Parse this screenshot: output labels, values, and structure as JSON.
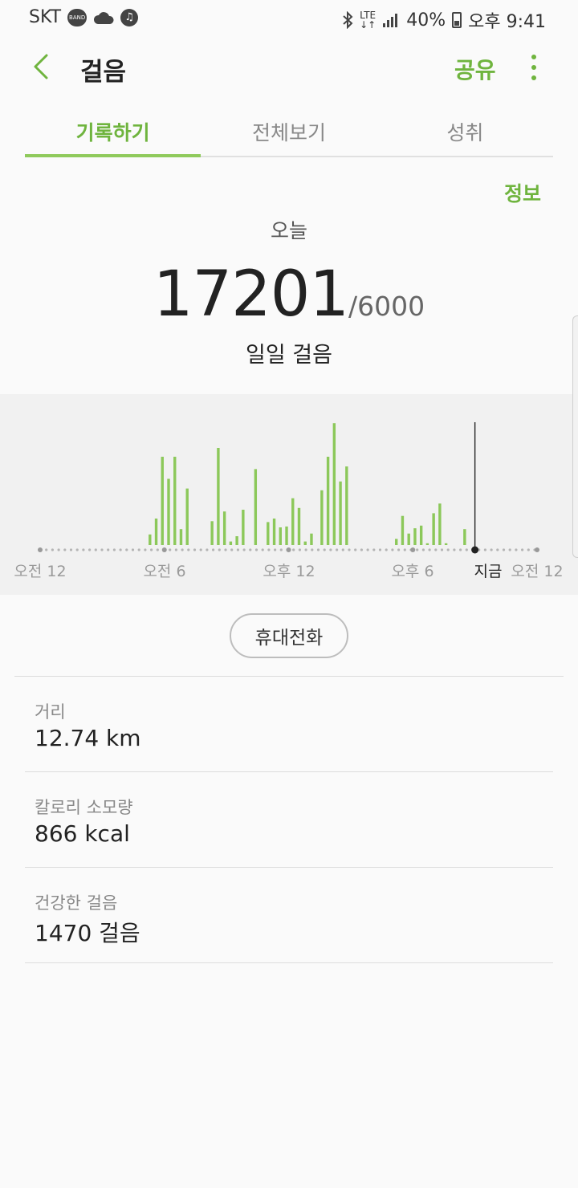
{
  "status_bar": {
    "carrier": "SKT",
    "network": "LTE",
    "battery": "40%",
    "time": "오후 9:41",
    "icons": [
      "band-icon",
      "cloud-icon",
      "music-icon",
      "bluetooth-icon",
      "lte-icon",
      "signal-icon",
      "battery-icon"
    ]
  },
  "app_bar": {
    "title": "걸음",
    "share": "공유"
  },
  "tabs": [
    {
      "label": "기록하기",
      "active": true
    },
    {
      "label": "전체보기",
      "active": false
    },
    {
      "label": "성취",
      "active": false
    }
  ],
  "info_link": "정보",
  "summary": {
    "today_label": "오늘",
    "steps": "17201",
    "goal": "/6000",
    "unit_label": "일일 걸음"
  },
  "chart_data": {
    "type": "bar",
    "x_labels": [
      "오전 12",
      "오전 6",
      "오후 12",
      "오후 6",
      "지금",
      "오전 12"
    ],
    "now_hour": 21,
    "bars": [
      [
        5.3,
        12
      ],
      [
        5.6,
        30
      ],
      [
        5.9,
        100
      ],
      [
        6.2,
        75
      ],
      [
        6.5,
        100
      ],
      [
        6.8,
        18
      ],
      [
        7.1,
        64
      ],
      [
        8.3,
        27
      ],
      [
        8.6,
        110
      ],
      [
        8.9,
        38
      ],
      [
        9.2,
        4
      ],
      [
        9.5,
        10
      ],
      [
        9.8,
        40
      ],
      [
        10.4,
        86
      ],
      [
        11.0,
        26
      ],
      [
        11.3,
        30
      ],
      [
        11.6,
        20
      ],
      [
        11.9,
        21
      ],
      [
        12.2,
        53
      ],
      [
        12.5,
        42
      ],
      [
        12.8,
        4
      ],
      [
        13.1,
        13
      ],
      [
        13.6,
        62
      ],
      [
        13.9,
        100
      ],
      [
        14.2,
        138
      ],
      [
        14.5,
        72
      ],
      [
        14.8,
        89
      ],
      [
        17.2,
        7
      ],
      [
        17.5,
        33
      ],
      [
        17.8,
        13
      ],
      [
        18.1,
        19
      ],
      [
        18.4,
        22
      ],
      [
        18.7,
        2
      ],
      [
        19.0,
        36
      ],
      [
        19.3,
        47
      ],
      [
        19.6,
        2
      ],
      [
        20.5,
        18
      ]
    ]
  },
  "device_button": "휴대전화",
  "stats": [
    {
      "label": "거리",
      "value": "12.74 km"
    },
    {
      "label": "칼로리 소모량",
      "value": "866 kcal"
    },
    {
      "label": "건강한 걸음",
      "value": "1470 걸음"
    }
  ],
  "colors": {
    "accent": "#6fb43e",
    "bar": "#8cc85a"
  }
}
